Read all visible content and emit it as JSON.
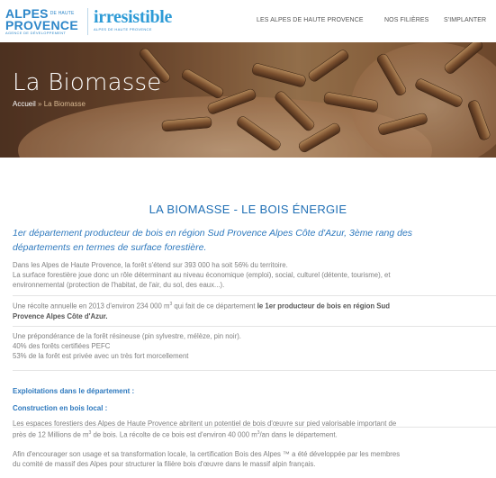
{
  "header": {
    "logo_alpes_line1": "ALPES",
    "logo_alpes_small": "DE HAUTE",
    "logo_alpes_line2": "PROVENCE",
    "logo_alpes_tagline": "AGENCE DE DÉVELOPPEMENT",
    "logo_irresistible": "irresistible",
    "logo_irresistible_sub": "ALPES DE HAUTE PROVENCE",
    "nav": [
      "LES ALPES DE HAUTE PROVENCE",
      "NOS FILIÈRES",
      "S'IMPLANTER"
    ]
  },
  "hero": {
    "title": "La Biomasse",
    "breadcrumb_home": "Accueil",
    "breadcrumb_sep": "»",
    "breadcrumb_current": "La Biomasse"
  },
  "content": {
    "heading": "LA BIOMASSE - LE BOIS ÉNERGIE",
    "lead_line1": "1er département producteur de bois en région Sud Provence Alpes Côte d'Azur,  3ème rang des",
    "lead_line2": "départements en termes de surface forestière.",
    "p1_line1": "Dans les Alpes de Haute Provence, la forêt s'étend sur 393 000 ha soit 56% du territoire.",
    "p1_line2": "La surface forestière joue donc un rôle déterminant au niveau économique (emploi), social, culturel (détente, tourisme), et",
    "p1_line3": "environnemental (protection de l'habitat, de l'air, du sol, des eaux...).",
    "p2_text": "Une récolte annuelle en 2013 d'environ 234 000 m",
    "p2_sup": "3",
    "p2_text2": " qui fait de ce département ",
    "p2_bold1": "le 1er producteur de bois en région Sud",
    "p2_bold2": "Provence Alpes Côte d'Azur.",
    "p3_line1": "Une prépondérance de la forêt résineuse (pin sylvestre, mélèze, pin noir).",
    "p3_line2": "40% des forêts certifiées PEFC",
    "p3_line3": "53% de la forêt est privée avec un très fort morcellement",
    "section1": "Exploitations dans le département :",
    "section2": "Construction en bois local :",
    "p4_line1": "Les espaces forestiers des Alpes de Haute Provence abritent un potentiel de bois d'œuvre sur pied valorisable important de",
    "p4_line2a": "près de 12 Millions de m",
    "p4_sup1": "3",
    "p4_line2b": " de bois. La récolte de ce bois est d'environ 40 000 m",
    "p4_sup2": "3",
    "p4_line2c": "/an dans le département.",
    "p5_line1": "Afin d'encourager son usage et sa transformation locale, la certification Bois des Alpes ™ a été développée par les membres",
    "p5_line2": "du comité de massif des Alpes pour structurer la filière bois d'œuvre dans le massif alpin français."
  }
}
